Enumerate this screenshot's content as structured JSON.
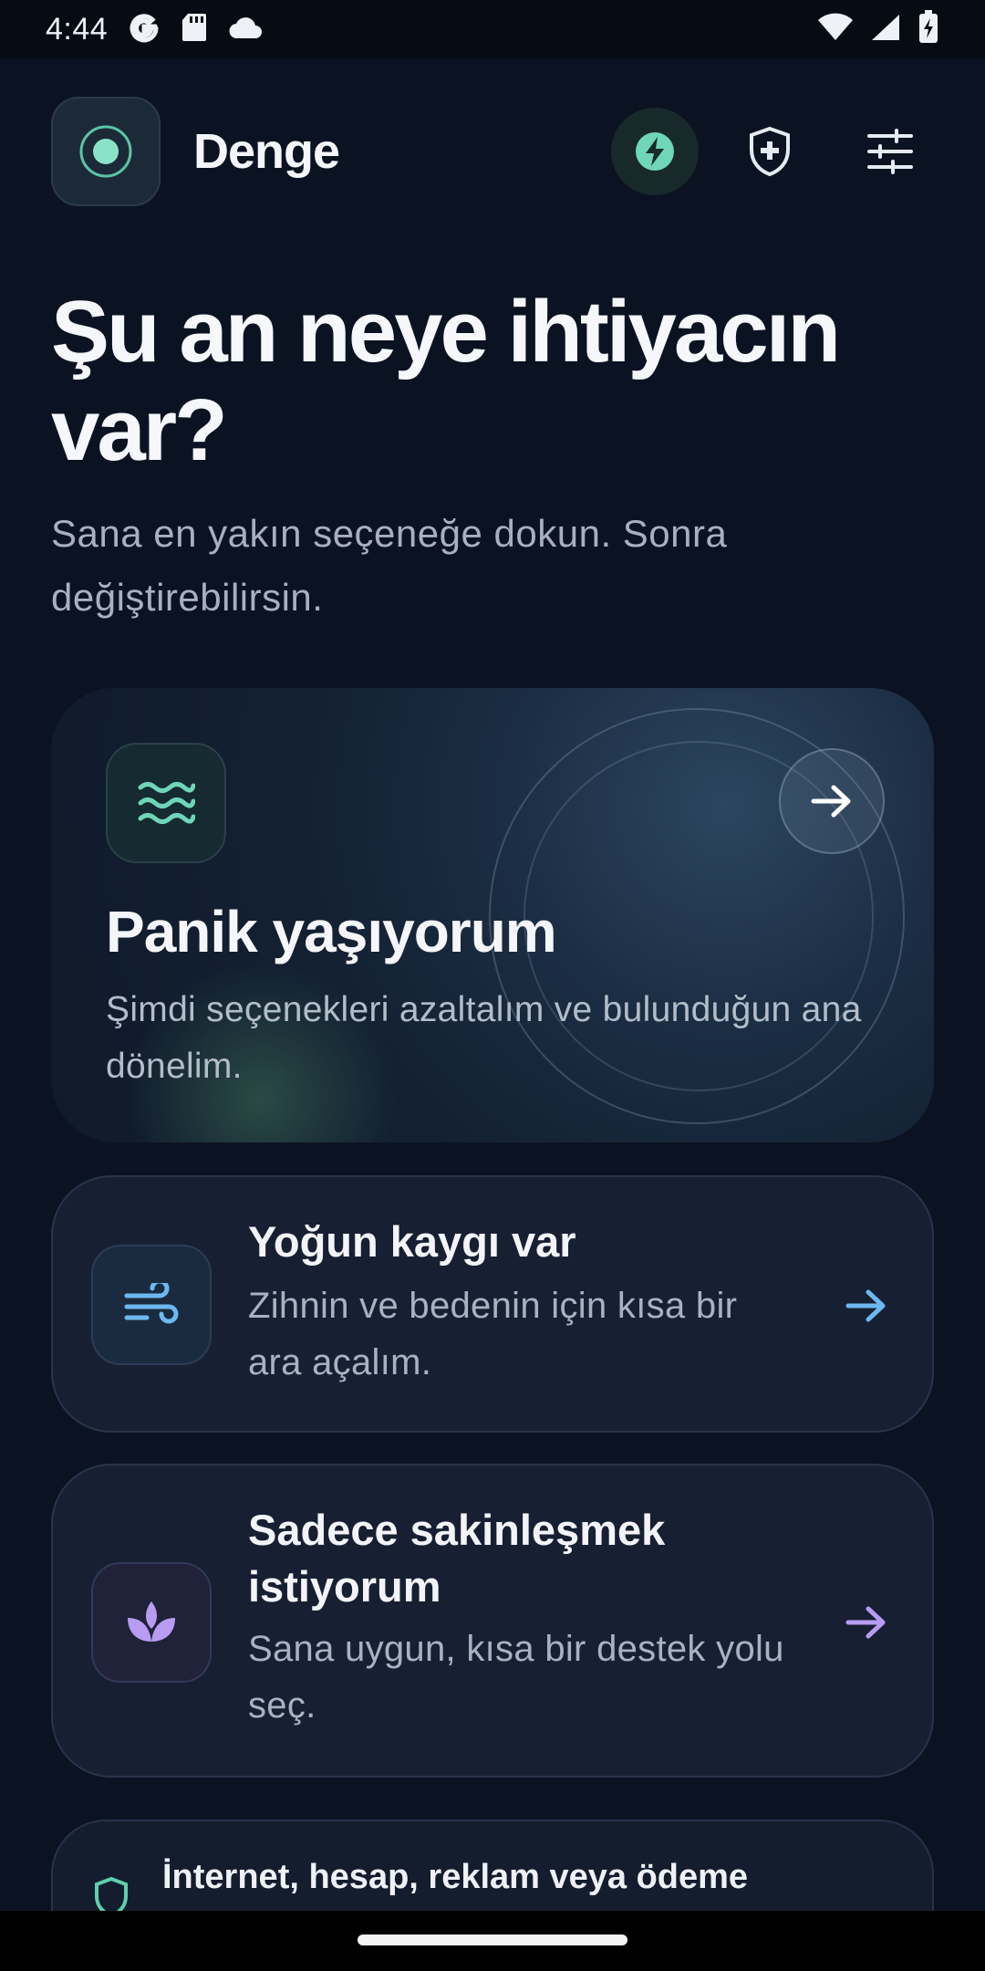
{
  "status_bar": {
    "time": "4:44",
    "icons": [
      "google-icon",
      "sd-card-icon",
      "cloud-icon",
      "wifi-icon",
      "signal-icon",
      "battery-charging-icon"
    ]
  },
  "header": {
    "app_name": "Denge",
    "actions": [
      "quick-action-bolt-icon",
      "shield-plus-icon",
      "settings-sliders-icon"
    ]
  },
  "headline": "Şu an neye ihtiyacın var?",
  "subheadline": "Sana en yakın seçeneğe dokun. Sonra değiştirebilirsin.",
  "options": [
    {
      "id": "panic",
      "title": "Panik yaşıyorum",
      "description": "Şimdi seçenekleri azaltalım ve bulunduğun ana dönelim.",
      "icon": "waves-icon",
      "accent": "#6fd6b8"
    },
    {
      "id": "anxiety",
      "title": "Yoğun kaygı var",
      "description": "Zihnin ve bedenin için kısa bir ara açalım.",
      "icon": "wind-icon",
      "accent": "#6cb8f0"
    },
    {
      "id": "calm",
      "title": "Sadece sakinleşmek istiyorum",
      "description": "Sana uygun, kısa bir destek yolu seç.",
      "icon": "lotus-icon",
      "accent": "#b79cf2"
    }
  ],
  "notice": {
    "text": "İnternet, hesap, reklam veya ödeme",
    "icon": "shield-icon",
    "accent": "#5fcfae"
  },
  "colors": {
    "background": "#0b1322",
    "card": "#172032",
    "mint": "#6fd6b8",
    "blue": "#6cb8f0",
    "purple": "#b79cf2"
  }
}
